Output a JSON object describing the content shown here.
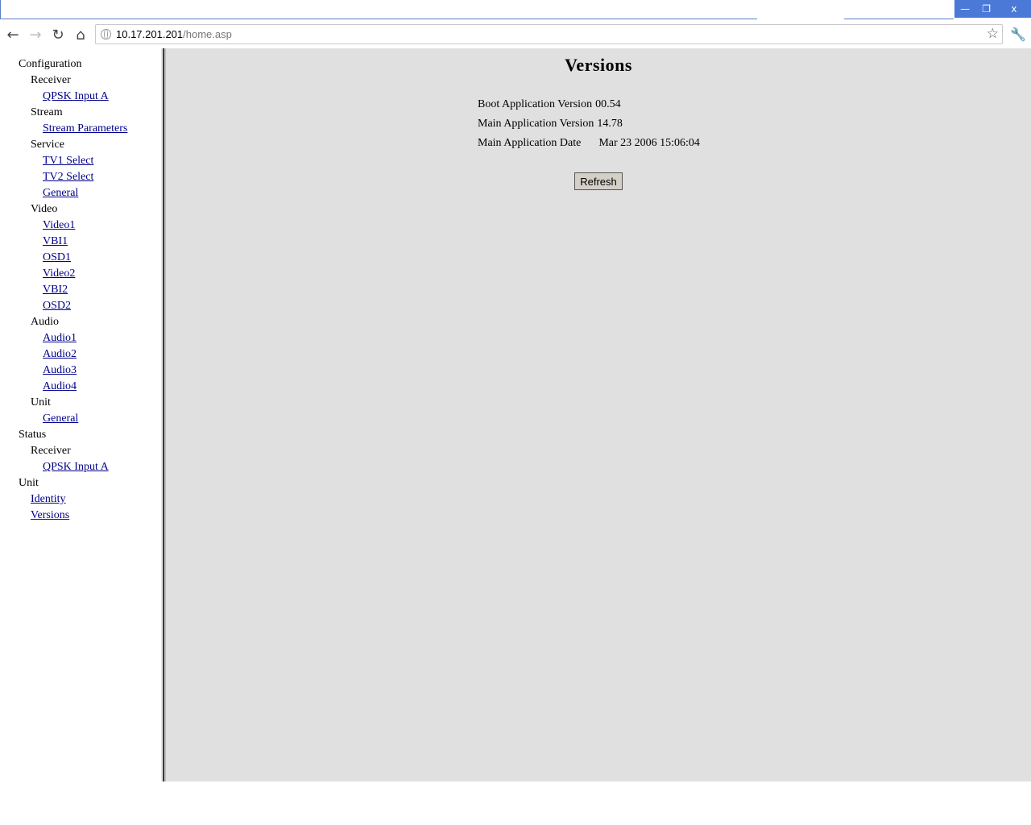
{
  "window": {
    "minimize_label": "—",
    "restore_label": "❐",
    "close_label": "x"
  },
  "toolbar": {
    "back_icon": "←",
    "forward_icon": "→",
    "reload_icon": "↻",
    "home_icon": "⌂",
    "url_host": "10.17.201.201",
    "url_path": "/home.asp",
    "bookmark_icon": "☆",
    "wrench_icon": "🔧"
  },
  "nav": {
    "configuration": "Configuration",
    "receiver": "Receiver",
    "qpsk_input_a": "QPSK Input A",
    "stream": "Stream",
    "stream_parameters": "Stream Parameters",
    "service": "Service",
    "tv1_select": "TV1 Select",
    "tv2_select": "TV2 Select",
    "service_general": "General",
    "video": "Video",
    "video1": "Video1",
    "vbi1": "VBI1",
    "osd1": "OSD1",
    "video2": "Video2",
    "vbi2": "VBI2",
    "osd2": "OSD2",
    "audio": "Audio",
    "audio1": "Audio1",
    "audio2": "Audio2",
    "audio3": "Audio3",
    "audio4": "Audio4",
    "unit": "Unit",
    "unit_general": "General",
    "status": "Status",
    "status_receiver": "Receiver",
    "status_qpsk_input_a": "QPSK Input A",
    "unit_top": "Unit",
    "identity": "Identity",
    "versions": "Versions"
  },
  "main": {
    "title": "Versions",
    "rows": [
      {
        "label": "Boot Application Version",
        "value": "00.54"
      },
      {
        "label": "Main Application Version",
        "value": "14.78"
      },
      {
        "label": "Main Application Date",
        "value": "Mar 23 2006 15:06:04"
      }
    ],
    "refresh_label": "Refresh"
  },
  "colors": {
    "link": "#00008b",
    "content_bg": "#e0e0e0",
    "title_bar_accent": "#4a79d8"
  }
}
